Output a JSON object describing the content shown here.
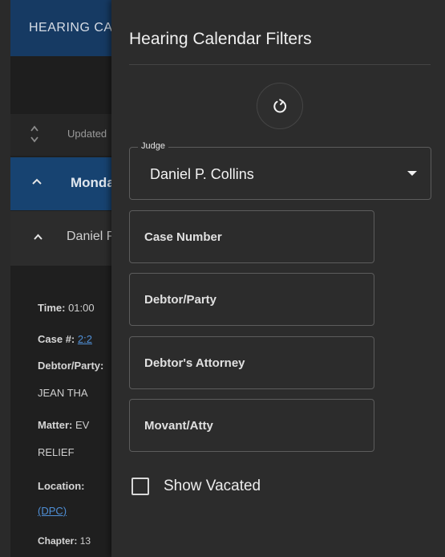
{
  "background": {
    "app_title": "HEARING CALENDAR",
    "update_text": "Updated",
    "day_header": "Monday",
    "judge_header": "Daniel P. Collins",
    "detail": {
      "time_label": "Time:",
      "time_value": "01:00",
      "case_label": "Case #:",
      "case_value": "2:2",
      "debtor_label": "Debtor/Party:",
      "debtor_value": "JEAN THA",
      "matter_label": "Matter:",
      "matter_value": "EV",
      "matter_value2": "RELIEF",
      "location_label": "Location:",
      "location_value": "(DPC)",
      "chapter_label": "Chapter:",
      "chapter_value": "13"
    }
  },
  "drawer": {
    "title": "Hearing Calendar Filters",
    "reset_icon": "refresh-icon",
    "judge": {
      "label": "Judge",
      "value": "Daniel P. Collins"
    },
    "case_number": {
      "placeholder": "Case Number"
    },
    "debtor_party": {
      "placeholder": "Debtor/Party"
    },
    "debtors_attorney": {
      "placeholder": "Debtor's Attorney"
    },
    "movant_atty": {
      "placeholder": "Movant/Atty"
    },
    "show_vacated": {
      "label": "Show Vacated",
      "checked": false
    }
  },
  "colors": {
    "appbar": "#163a63",
    "day_row": "#174371",
    "drawer_bg": "#2c2c2c",
    "link": "#4f8fd6"
  }
}
